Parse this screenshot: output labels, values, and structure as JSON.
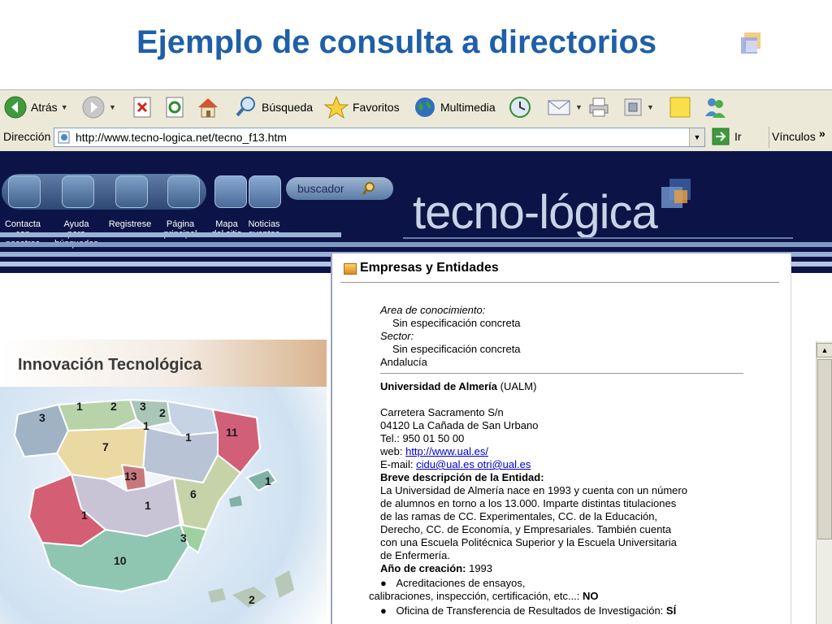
{
  "slide": {
    "title": "Ejemplo de consulta a directorios"
  },
  "browser": {
    "toolbar": {
      "back_label": "Atrás",
      "search_label": "Búsqueda",
      "favorites_label": "Favoritos",
      "multimedia_label": "Multimedia"
    },
    "address": {
      "label": "Dirección",
      "url": "http://www.tecno-logica.net/tecno_f13.htm",
      "go_label": "Ir",
      "links_label": "Vínculos",
      "links_more": "»"
    }
  },
  "site": {
    "brand": "tecno-lógica",
    "search_label": "buscador",
    "nav": [
      {
        "label_lines": [
          "Contacta",
          "con",
          "nosotros"
        ]
      },
      {
        "label_lines": [
          "Ayuda",
          "para",
          "búsquedas"
        ]
      },
      {
        "label_lines": [
          "Registrese"
        ]
      },
      {
        "label_lines": [
          "Página",
          "principal"
        ]
      },
      {
        "label_lines": [
          "Mapa",
          "del sitio"
        ]
      },
      {
        "label_lines": [
          "Noticias",
          "eventos"
        ]
      }
    ],
    "innovation_title": "Innovación Tecnológica",
    "map_numbers": [
      "3",
      "1",
      "2",
      "3",
      "2",
      "1",
      "7",
      "1",
      "11",
      "13",
      "6",
      "1",
      "1",
      "1",
      "3",
      "10",
      "2"
    ]
  },
  "panel": {
    "title": "Empresas y Entidades",
    "area_label": "Area de conocimiento:",
    "area_value": "Sin especificación concreta",
    "sector_label": "Sector:",
    "sector_value": "Sin especificación concreta",
    "region": "Andalucía",
    "entity_name": "Universidad de Almería",
    "entity_abbr": "(UALM)",
    "address_line1": "Carretera Sacramento S/n",
    "address_line2": "04120 La Cañada de San Urbano",
    "phone": "Tel.: 950 01 50 00",
    "web_label": "web:",
    "web_url": "http://www.ual.es/",
    "email_label": "E-mail:",
    "email_value": "cidu@ual.es otri@ual.es",
    "description_heading": "Breve descripción de la Entidad:",
    "description_lines": [
      "La Universidad de Almería nace en 1993 y cuenta con un número",
      "de alumnos en torno a los 13.000. Imparte distintas titulaciones",
      "de las ramas de CC. Experimentales, CC. de la Educación,",
      "Derecho, CC. de Economía, y Empresariales. También cuenta",
      "con una Escuela Politécnica Superior y la Escuela Universitaria",
      "de Enfermería."
    ],
    "founded_label": "Año de creación:",
    "founded_value": "1993",
    "bullet1_line1": "Acreditaciones de ensayos,",
    "bullet1_line2": "calibraciones, inspección, certificación, etc...:",
    "bullet1_value": "NO",
    "bullet2_text": "Oficina de Transferencia de Resultados de Investigación:",
    "bullet2_value": "SÍ"
  }
}
